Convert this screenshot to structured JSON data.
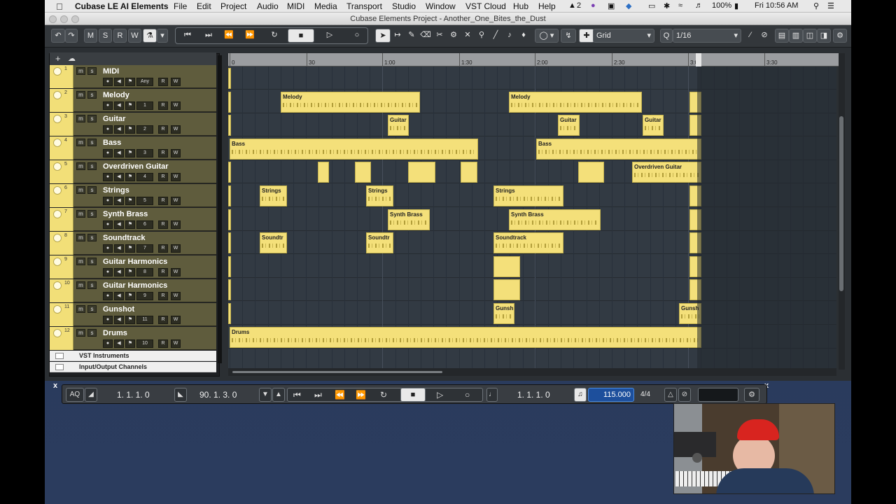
{
  "menubar": {
    "app": "Cubase LE AI Elements",
    "items": [
      "File",
      "Edit",
      "Project",
      "Audio",
      "MIDI",
      "Media",
      "Transport",
      "Studio",
      "Window",
      "VST Cloud",
      "Hub",
      "Help"
    ],
    "adobe_count": "2",
    "battery": "100%",
    "clock": "Fri 10:56 AM"
  },
  "window": {
    "title": "Cubase Elements Project - Another_One_Bites_the_Dust"
  },
  "toolbar": {
    "mode_buttons": [
      "M",
      "S",
      "R",
      "W"
    ],
    "snap_label": "Grid",
    "quantize": "1/16"
  },
  "tracks": [
    {
      "num": "1",
      "name": "MIDI",
      "channel": "Any"
    },
    {
      "num": "2",
      "name": "Melody",
      "channel": "1"
    },
    {
      "num": "3",
      "name": "Guitar",
      "channel": "2"
    },
    {
      "num": "4",
      "name": "Bass",
      "channel": "3"
    },
    {
      "num": "5",
      "name": "Overdriven Guitar",
      "channel": "4"
    },
    {
      "num": "6",
      "name": "Strings",
      "channel": "5"
    },
    {
      "num": "7",
      "name": "Synth Brass",
      "channel": "6"
    },
    {
      "num": "8",
      "name": "Soundtrack",
      "channel": "7"
    },
    {
      "num": "9",
      "name": "Guitar Harmonics",
      "channel": "8"
    },
    {
      "num": "10",
      "name": "Guitar Harmonics",
      "channel": "9"
    },
    {
      "num": "11",
      "name": "Gunshot",
      "channel": "11"
    },
    {
      "num": "12",
      "name": "Drums",
      "channel": "10"
    }
  ],
  "folders": [
    "VST Instruments",
    "Input/Output Channels"
  ],
  "track_buttons": {
    "mute": "m",
    "solo": "s",
    "read": "R",
    "write": "W"
  },
  "ruler": {
    "labels": [
      "0",
      "30",
      "1:00",
      "1:30",
      "2:00",
      "2:30",
      "3:00",
      "3:30"
    ]
  },
  "parts": [
    {
      "lane": 1,
      "label": "Melody"
    },
    {
      "lane": 1,
      "label": "Melody"
    },
    {
      "lane": 2,
      "label": "Guitar"
    },
    {
      "lane": 2,
      "label": "Guitar"
    },
    {
      "lane": 2,
      "label": "Guitar"
    },
    {
      "lane": 3,
      "label": "Bass"
    },
    {
      "lane": 3,
      "label": "Bass"
    },
    {
      "lane": 4,
      "label": "Overdriven Guitar"
    },
    {
      "lane": 5,
      "label": "Strings"
    },
    {
      "lane": 5,
      "label": "Strings"
    },
    {
      "lane": 5,
      "label": "Strings"
    },
    {
      "lane": 6,
      "label": "Synth Brass"
    },
    {
      "lane": 6,
      "label": "Synth Brass"
    },
    {
      "lane": 7,
      "label": "Soundtr"
    },
    {
      "lane": 7,
      "label": "Soundtr"
    },
    {
      "lane": 7,
      "label": "Soundtrack"
    },
    {
      "lane": 10,
      "label": "Gunsh"
    },
    {
      "lane": 10,
      "label": "Gunsh"
    },
    {
      "lane": 11,
      "label": "Drums"
    }
  ],
  "transport": {
    "aq": "AQ",
    "left_locator": "1. 1. 1.   0",
    "right_locator": "90. 1. 3.   0",
    "position": "1. 1. 1.   0",
    "tempo": "115.000",
    "signature": "4/4"
  },
  "close_label": "x",
  "colors": {
    "track_color": "#f2df78",
    "part_color": "#f4e07a",
    "track_bg": "#5f5c3d",
    "arranger_bg": "#323a43"
  }
}
